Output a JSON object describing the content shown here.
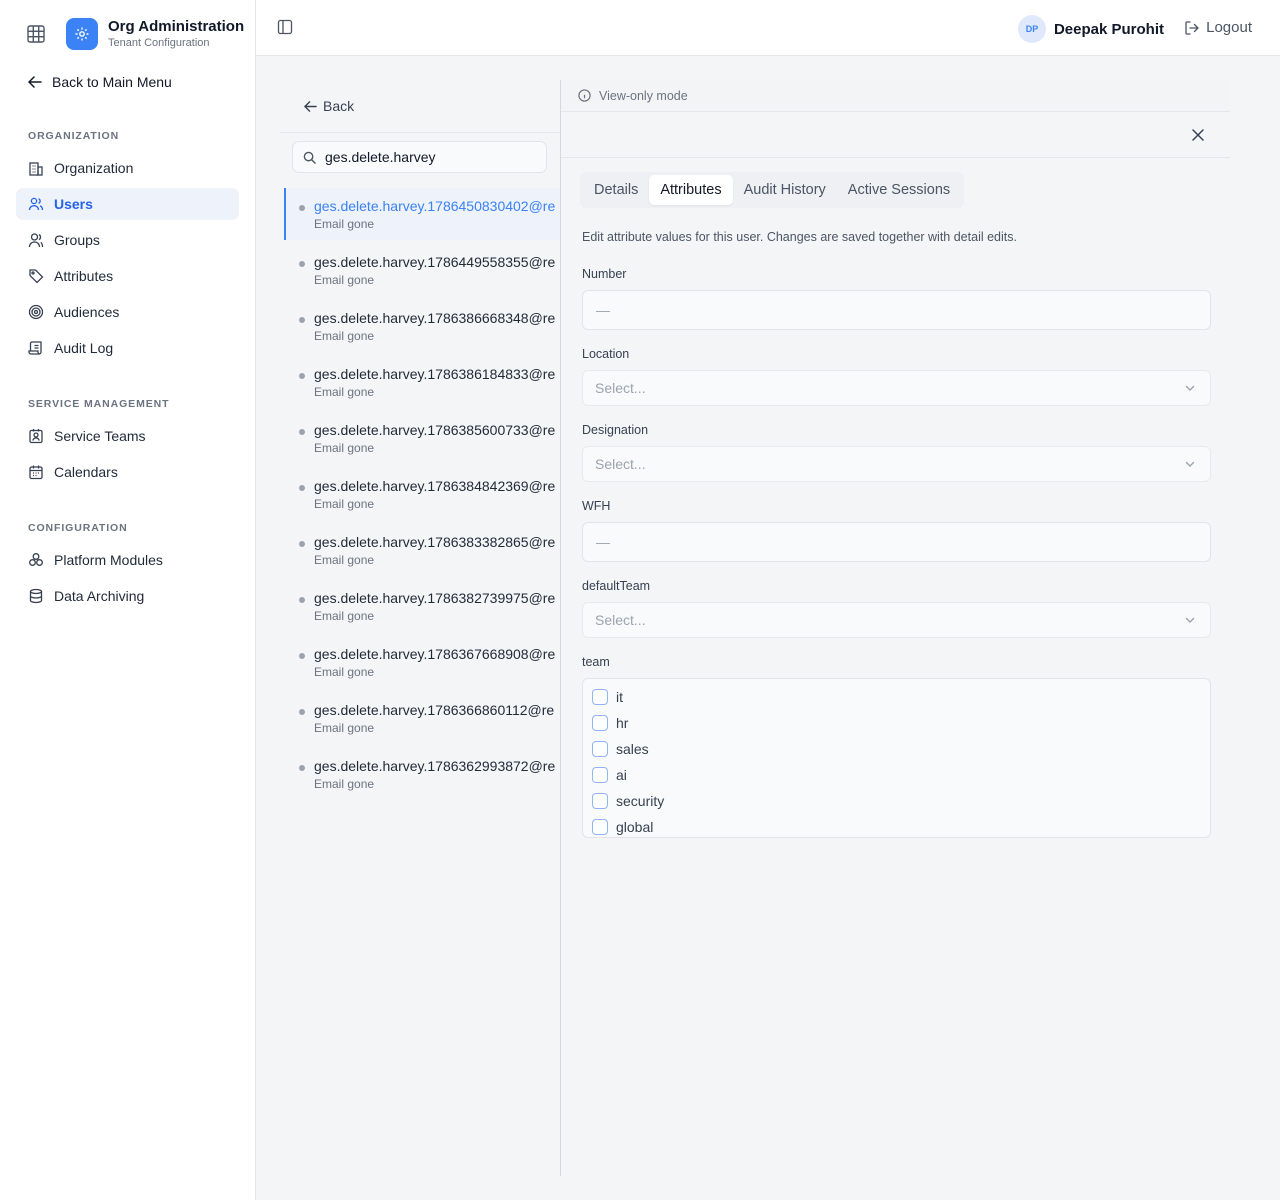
{
  "app": {
    "title": "Org Administration",
    "subtitle": "Tenant Configuration",
    "back_to_main": "Back to Main Menu"
  },
  "sidebar": {
    "sections": [
      {
        "title": "ORGANIZATION",
        "items": [
          {
            "label": "Organization",
            "icon": "building-icon"
          },
          {
            "label": "Users",
            "icon": "users-icon",
            "active": true
          },
          {
            "label": "Groups",
            "icon": "groups-icon"
          },
          {
            "label": "Attributes",
            "icon": "tag-icon"
          },
          {
            "label": "Audiences",
            "icon": "target-icon"
          },
          {
            "label": "Audit Log",
            "icon": "scroll-icon"
          }
        ]
      },
      {
        "title": "SERVICE MANAGEMENT",
        "items": [
          {
            "label": "Service Teams",
            "icon": "contact-badge-icon"
          },
          {
            "label": "Calendars",
            "icon": "calendar-icon"
          }
        ]
      },
      {
        "title": "CONFIGURATION",
        "items": [
          {
            "label": "Platform Modules",
            "icon": "modules-icon"
          },
          {
            "label": "Data Archiving",
            "icon": "database-icon"
          }
        ]
      }
    ]
  },
  "header": {
    "user_initials": "DP",
    "user_name": "Deepak Purohit",
    "logout_label": "Logout"
  },
  "list": {
    "back_label": "Back",
    "search_value": "ges.delete.harvey",
    "users": [
      {
        "email": "ges.delete.harvey.1786450830402@re",
        "status": "Email gone",
        "selected": true
      },
      {
        "email": "ges.delete.harvey.1786449558355@re",
        "status": "Email gone"
      },
      {
        "email": "ges.delete.harvey.1786386668348@re",
        "status": "Email gone"
      },
      {
        "email": "ges.delete.harvey.1786386184833@re",
        "status": "Email gone"
      },
      {
        "email": "ges.delete.harvey.1786385600733@re",
        "status": "Email gone"
      },
      {
        "email": "ges.delete.harvey.1786384842369@re",
        "status": "Email gone"
      },
      {
        "email": "ges.delete.harvey.1786383382865@re",
        "status": "Email gone"
      },
      {
        "email": "ges.delete.harvey.1786382739975@re",
        "status": "Email gone"
      },
      {
        "email": "ges.delete.harvey.1786367668908@re",
        "status": "Email gone"
      },
      {
        "email": "ges.delete.harvey.1786366860112@re",
        "status": "Email gone"
      },
      {
        "email": "ges.delete.harvey.1786362993872@re",
        "status": "Email gone"
      }
    ]
  },
  "detail": {
    "view_only": "View-only mode",
    "tabs": [
      "Details",
      "Attributes",
      "Audit History",
      "Active Sessions"
    ],
    "active_tab": "Attributes",
    "help_text": "Edit attribute values for this user. Changes are saved together with detail edits.",
    "fields": {
      "number": {
        "label": "Number",
        "value": "—"
      },
      "location": {
        "label": "Location",
        "placeholder": "Select..."
      },
      "designation": {
        "label": "Designation",
        "placeholder": "Select..."
      },
      "wfh": {
        "label": "WFH",
        "value": "—"
      },
      "default_team": {
        "label": "defaultTeam",
        "placeholder": "Select..."
      },
      "team": {
        "label": "team",
        "options": [
          "it",
          "hr",
          "sales",
          "ai",
          "security",
          "global"
        ]
      }
    }
  },
  "colors": {
    "accent": "#3b82f6",
    "active_bg": "#eef2fb",
    "page_bg": "#f4f5f7"
  }
}
